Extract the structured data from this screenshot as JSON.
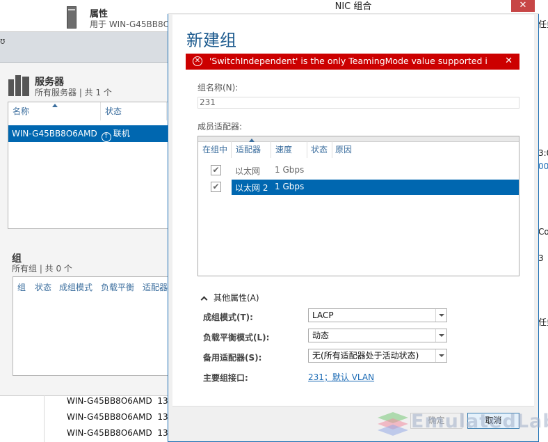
{
  "background": {
    "properties": {
      "title": "属性",
      "subtitle": "用于 WIN-G45BB8O"
    },
    "titlebar_glyph": "ʊ",
    "servers": {
      "title": "服务器",
      "subtitle": "所有服务器 | 共 1 个",
      "columns": [
        "名称",
        "状态"
      ],
      "rows": [
        {
          "name": "WIN-G45BB8O6AMD",
          "status": "联机"
        }
      ]
    },
    "groups": {
      "title": "组",
      "subtitle": "所有组 | 共 0 个",
      "columns": [
        "组",
        "状态",
        "成组模式",
        "负载平衡",
        "适配器"
      ]
    },
    "bottom_rows": [
      {
        "name": "WIN-G45BB8O6AMD",
        "value": "13"
      },
      {
        "name": "WIN-G45BB8O6AMD",
        "value": "13"
      },
      {
        "name": "WIN-G45BB8O6AMD",
        "value": "13"
      }
    ],
    "right_fragments": [
      "任务",
      "3:0",
      "00",
      "Co",
      "3",
      "任务"
    ]
  },
  "dialog": {
    "window_title": "NIC 组合",
    "close_glyph": "✕",
    "heading": "新建组",
    "error": {
      "icon": "✕",
      "text": "'SwitchIndependent' is the only TeamingMode value supported in a...",
      "dismiss": "✕"
    },
    "team_name": {
      "label": "组名称(N):",
      "value": "231"
    },
    "members": {
      "label": "成员适配器:",
      "columns": [
        "在组中",
        "适配器",
        "速度",
        "状态",
        "原因"
      ],
      "rows": [
        {
          "checked": "✔",
          "adapter": "以太网",
          "speed": "1 Gbps",
          "selected": false
        },
        {
          "checked": "✔",
          "adapter": "以太网 2",
          "speed": "1 Gbps",
          "selected": true
        }
      ]
    },
    "additional": {
      "toggle_label": "其他属性(A)",
      "teaming_mode": {
        "label": "成组模式(T):",
        "value": "LACP"
      },
      "load_balancing": {
        "label": "负载平衡模式(L):",
        "value": "动态"
      },
      "standby": {
        "label": "备用适配器(S):",
        "value": "无(所有适配器处于活动状态)"
      },
      "primary_interface": {
        "label": "主要组接口:",
        "value": "231；默认 VLAN"
      }
    },
    "buttons": {
      "ok": "确定",
      "cancel": "取消"
    }
  },
  "watermark": {
    "text": "EmulatedLab"
  }
}
